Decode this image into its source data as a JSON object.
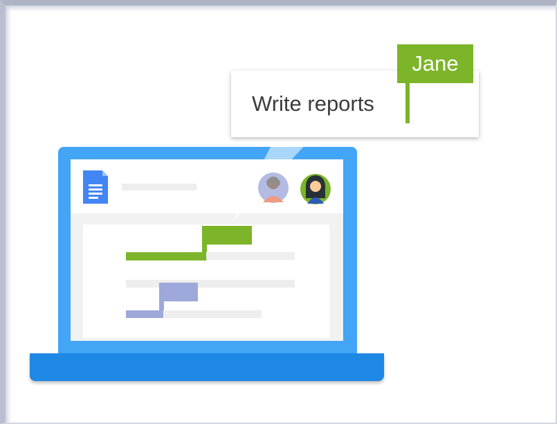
{
  "tooltip": {
    "text": "Write reports"
  },
  "collaborator_tag": {
    "name": "Jane"
  },
  "colors": {
    "laptop_lid": "#42a5f5",
    "laptop_base": "#1e88e5",
    "jane_green": "#7cb529",
    "other_user_purple": "#9fa8da",
    "doc_icon": "#4285f4"
  },
  "icons": [
    "google-docs-icon",
    "user-avatar-icon",
    "jane-avatar-icon"
  ]
}
